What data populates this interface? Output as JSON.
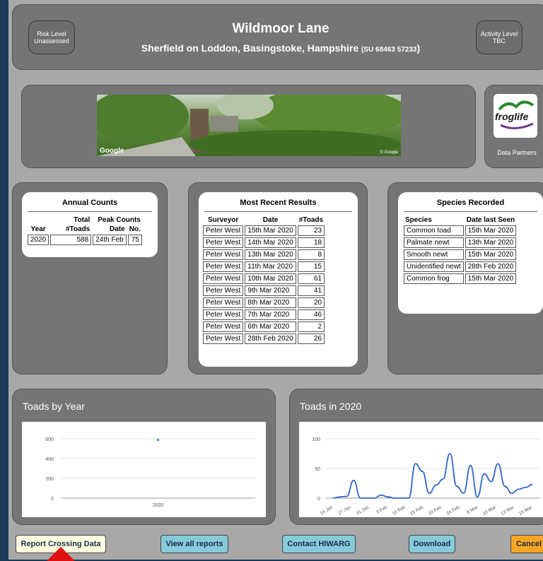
{
  "header": {
    "risk_level_label": "Risk Level",
    "risk_level_value": "Unassessed",
    "title": "Wildmoor Lane",
    "subtitle": "Sherfield on Loddon, Basingstoke, Hampshire",
    "grid_ref": "SU 68463 57233",
    "activity_label": "Activity Level",
    "activity_value": "TBC"
  },
  "streetview": {
    "watermark_left": "Google",
    "watermark_right": "© Google"
  },
  "partners": {
    "logo_text": "froglife",
    "label": "Data Partners"
  },
  "annual_counts": {
    "title": "Annual Counts",
    "headers": {
      "total": "Total",
      "peak": "Peak Counts",
      "year": "Year",
      "toads": "#Toads",
      "date": "Date",
      "no": "No."
    },
    "rows": [
      {
        "year": "2020",
        "toads": "588",
        "date": "24th Feb",
        "no": "75"
      }
    ]
  },
  "recent_results": {
    "title": "Most Recent Results",
    "headers": {
      "surveyor": "Surveyor",
      "date": "Date",
      "toads": "#Toads"
    },
    "rows": [
      {
        "surveyor": "Peter West",
        "date": "15th Mar 2020",
        "toads": "23"
      },
      {
        "surveyor": "Peter West",
        "date": "14th Mar 2020",
        "toads": "18"
      },
      {
        "surveyor": "Peter West",
        "date": "13th Mar 2020",
        "toads": "8"
      },
      {
        "surveyor": "Peter West",
        "date": "11th Mar 2020",
        "toads": "15"
      },
      {
        "surveyor": "Peter West",
        "date": "10th Mar 2020",
        "toads": "61"
      },
      {
        "surveyor": "Peter West",
        "date": "9th Mar 2020",
        "toads": "41"
      },
      {
        "surveyor": "Peter West",
        "date": "8th Mar 2020",
        "toads": "20"
      },
      {
        "surveyor": "Peter West",
        "date": "7th Mar 2020",
        "toads": "46"
      },
      {
        "surveyor": "Peter West",
        "date": "6th Mar 2020",
        "toads": "2"
      },
      {
        "surveyor": "Peter West",
        "date": "28th Feb 2020",
        "toads": "26"
      }
    ]
  },
  "species": {
    "title": "Species Recorded",
    "headers": {
      "species": "Species",
      "date": "Date last Seen"
    },
    "rows": [
      {
        "species": "Common toad",
        "date": "15th Mar 2020"
      },
      {
        "species": "Palmate newt",
        "date": "13th Mar 2020"
      },
      {
        "species": "Smooth newt",
        "date": "15th Mar 2020"
      },
      {
        "species": "Unidentified newt",
        "date": "28th Feb 2020"
      },
      {
        "species": "Common frog",
        "date": "15th Mar 2020"
      }
    ]
  },
  "chart_data": [
    {
      "type": "scatter",
      "title": "Toads by Year",
      "x": [
        "2020"
      ],
      "values": [
        588
      ],
      "yticks": [
        "600",
        "400",
        "200",
        "0"
      ],
      "ylim": [
        0,
        600
      ],
      "color": "#3366cc"
    },
    {
      "type": "line",
      "title": "Toads in 2020",
      "categories": [
        "14 Jan",
        "27 Jan",
        "31 Jan",
        "3 Feb",
        "10 Feb",
        "19 Feb",
        "22 Feb",
        "24 Feb",
        "8 Mar",
        "10 Mar",
        "13 Mar",
        "15 Mar"
      ],
      "values": [
        0,
        2,
        3,
        30,
        0,
        0,
        0,
        5,
        2,
        0,
        0,
        0,
        58,
        45,
        8,
        22,
        32,
        75,
        20,
        8,
        55,
        2,
        41,
        28,
        58,
        20,
        8,
        15,
        18,
        23
      ],
      "yticks": [
        "100",
        "50",
        "0"
      ],
      "ylim": [
        0,
        100
      ],
      "color": "#3366cc"
    }
  ],
  "buttons": {
    "report": "Report Crossing Data",
    "view_all": "View all reports",
    "contact": "Contact HIWARG",
    "download": "Download",
    "cancel": "Cancel"
  },
  "colors": {
    "report_bg": "#ffffe0",
    "blue_btn_bg": "#87cbd8",
    "cancel_bg": "#f5a623",
    "line": "#3366cc"
  }
}
